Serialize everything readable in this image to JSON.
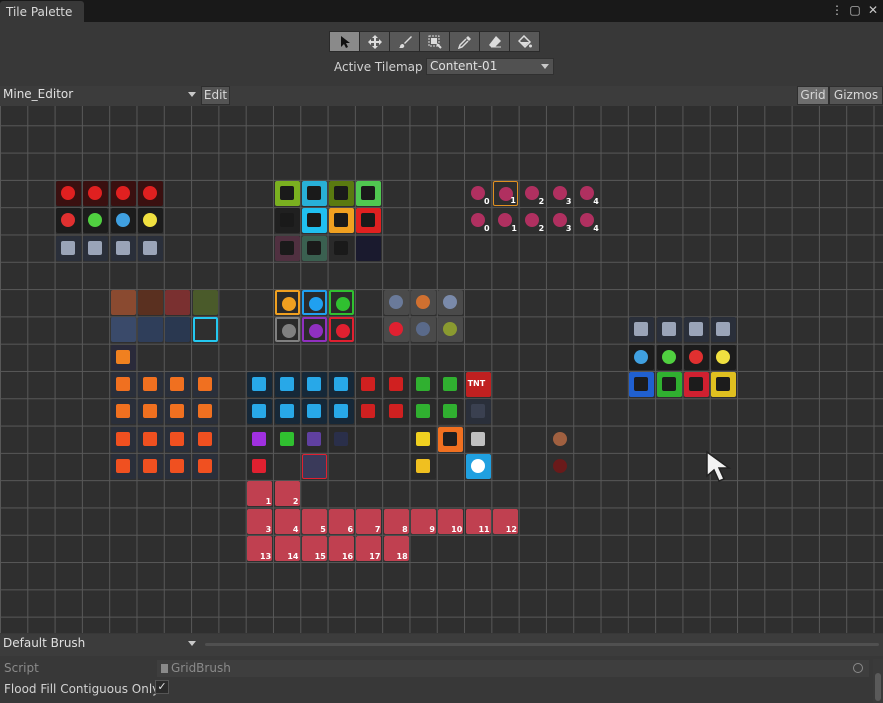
{
  "window": {
    "tab_title": "Tile Palette",
    "menu_icon": "kebab-menu-icon",
    "maximize_icon": "maximize-icon",
    "close_icon": "close-icon"
  },
  "toolbar": {
    "tools": [
      {
        "name": "select-tool",
        "icon": "arrow-select-icon",
        "active": true
      },
      {
        "name": "move-tool",
        "icon": "move-icon",
        "active": false
      },
      {
        "name": "paint-tool",
        "icon": "paintbrush-icon",
        "active": false
      },
      {
        "name": "box-fill-tool",
        "icon": "box-fill-icon",
        "active": false
      },
      {
        "name": "pick-tool",
        "icon": "eyedropper-icon",
        "active": false
      },
      {
        "name": "erase-tool",
        "icon": "eraser-icon",
        "active": false
      },
      {
        "name": "fill-tool",
        "icon": "paint-bucket-icon",
        "active": false
      }
    ],
    "active_tilemap_label": "Active Tilemap",
    "active_tilemap_value": "Content-01"
  },
  "palette_bar": {
    "palette_value": "Mine_Editor",
    "edit_label": "Edit",
    "grid_label": "Grid",
    "gizmos_label": "Gizmos"
  },
  "tile_labels": {
    "rail_numbers": [
      "1",
      "2",
      "3",
      "4",
      "5",
      "6",
      "7",
      "8",
      "9",
      "10",
      "11",
      "12",
      "13",
      "14",
      "15",
      "16",
      "17",
      "18"
    ],
    "wire_numbers": [
      "0",
      "1",
      "2",
      "3",
      "4"
    ],
    "tnt_label": "TNT"
  },
  "brush": {
    "brush_value": "Default Brush",
    "script_label": "Script",
    "script_value": "GridBrush",
    "flood_fill_label": "Flood Fill Contiguous Only",
    "flood_fill_checked": "✓"
  },
  "colors": {
    "panel_bg": "#383838",
    "grid_bg": "#2f2f2f",
    "grid_line": "#585858",
    "selection_outline": "#e09020",
    "highlight_cyan": "#24c8f0"
  }
}
